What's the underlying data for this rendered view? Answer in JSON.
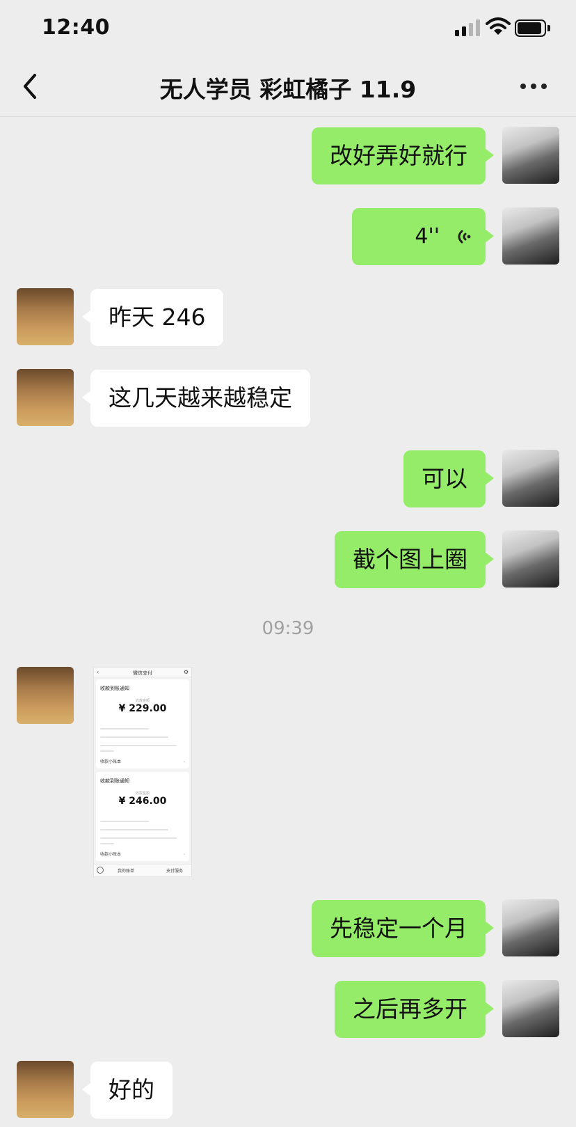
{
  "status_bar": {
    "time": "12:40"
  },
  "header": {
    "title": "无人学员 彩虹橘子 11.9"
  },
  "messages": {
    "m1": {
      "sender": "self",
      "text": "改好弄好就行"
    },
    "m2": {
      "sender": "self",
      "type": "voice",
      "duration": "4''"
    },
    "m3": {
      "sender": "other",
      "text": "昨天 246"
    },
    "m4": {
      "sender": "other",
      "text": "这几天越来越稳定"
    },
    "m5": {
      "sender": "self",
      "text": "可以"
    },
    "m6": {
      "sender": "self",
      "text": "截个图上圈"
    },
    "time_separator": "09:39",
    "m7": {
      "sender": "other",
      "type": "image",
      "screenshot": {
        "header_title": "微信支付",
        "cards": [
          {
            "heading": "收款到账通知",
            "sublabel": "收款金额",
            "amount": "¥ 229.00",
            "footer": "收款小账本"
          },
          {
            "heading": "收款到账通知",
            "sublabel": "收款金额",
            "amount": "¥ 246.00",
            "footer": "收款小账本"
          }
        ],
        "bottom_bar": {
          "left": "我的账单",
          "right": "支付服务"
        }
      }
    },
    "m8": {
      "sender": "self",
      "text": "先稳定一个月"
    },
    "m9": {
      "sender": "self",
      "text": "之后再多开"
    },
    "m10": {
      "sender": "other",
      "text": "好的"
    }
  },
  "colors": {
    "self_bubble": "#95ec69",
    "other_bubble": "#ffffff",
    "background": "#ededed"
  },
  "icons": {
    "back": "chevron-left-icon",
    "more": "more-dots-icon",
    "voice": "voice-wave-icon"
  }
}
